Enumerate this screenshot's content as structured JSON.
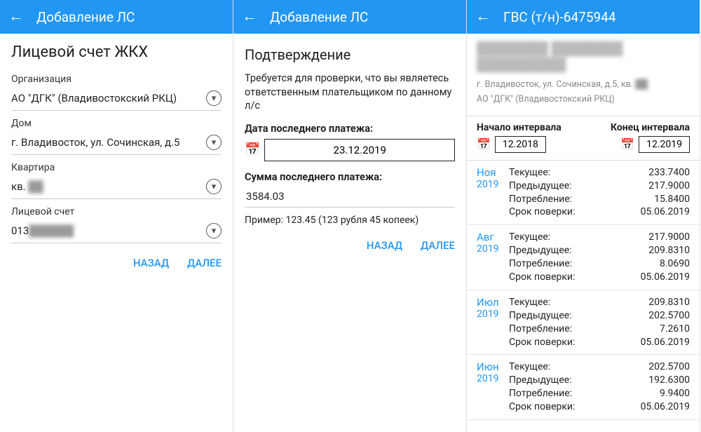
{
  "screen1": {
    "appbar_title": "Добавление ЛС",
    "heading": "Лицевой счет ЖКХ",
    "org_label": "Организация",
    "org_value": "АО \"ДГК\" (Владивостокский РКЦ)",
    "house_label": "Дом",
    "house_value": "г. Владивосток, ул. Сочинская, д.5",
    "flat_label": "Квартира",
    "flat_prefix": "кв.",
    "account_label": "Лицевой счет",
    "account_prefix": "013",
    "back": "НАЗАД",
    "next": "ДАЛЕЕ"
  },
  "screen2": {
    "appbar_title": "Добавление ЛС",
    "heading": "Подтверждение",
    "desc": "Требуется для проверки, что вы являетесь ответственным плательщиком по данному л/с",
    "date_label": "Дата последнего платежа:",
    "date_value": "23.12.2019",
    "sum_label": "Сумма последнего платежа:",
    "sum_value": "3584.03",
    "hint": "Пример: 123.45 (123 рубля 45 копеек)",
    "back": "НАЗАД",
    "next": "ДАЛЕЕ"
  },
  "screen3": {
    "appbar_title": "ГВС (т/н)-6475944",
    "owner_line1": "████████ ████████",
    "owner_line2": "██████████",
    "address": "г. Владивосток, ул. Сочинская, д.5, кв.",
    "org": "АО \"ДГК\" (Владивостокский РКЦ)",
    "range_start_label": "Начало интервала",
    "range_start_value": "12.2018",
    "range_end_label": "Конец интервала",
    "range_end_value": "12.2019",
    "labels": {
      "current": "Текущее:",
      "prev": "Предыдущее:",
      "cons": "Потребление:",
      "check": "Срок поверки:"
    },
    "entries": [
      {
        "month": "Ноя",
        "year": "2019",
        "current": "233.7400",
        "prev": "217.9000",
        "cons": "15.8400",
        "check": "05.06.2019"
      },
      {
        "month": "Авг",
        "year": "2019",
        "current": "217.9000",
        "prev": "209.8310",
        "cons": "8.0690",
        "check": "05.06.2019"
      },
      {
        "month": "Июл",
        "year": "2019",
        "current": "209.8310",
        "prev": "202.5700",
        "cons": "7.2610",
        "check": "05.06.2019"
      },
      {
        "month": "Июн",
        "year": "2019",
        "current": "202.5700",
        "prev": "192.6300",
        "cons": "9.9400",
        "check": "05.06.2019"
      }
    ]
  }
}
